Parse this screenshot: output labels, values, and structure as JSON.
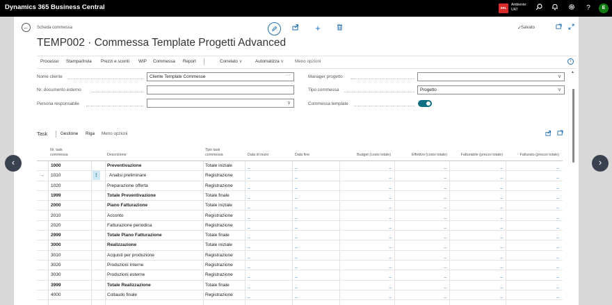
{
  "app": {
    "title": "Dynamics 365 Business Central"
  },
  "env": {
    "logo_text": "SRL",
    "line1": "Ambiente:",
    "line2": "UAT"
  },
  "user": {
    "initial": "E"
  },
  "page": {
    "breadcrumb": "Scheda commessa",
    "title": "TEMP002 · Commessa Template Progetti Advanced",
    "saved": "Salvato"
  },
  "menu": {
    "items": [
      "Processo",
      "Stampa/Invia",
      "Prezzi e sconti",
      "WIP",
      "Commessa",
      "Report",
      "Correlato",
      "Automatizza",
      "Meno opzioni"
    ]
  },
  "fields": {
    "nome_cliente": {
      "label": "Nome cliente",
      "value": "Cliente Template Commesse"
    },
    "nr_documento": {
      "label": "Nr. documento esterno",
      "value": ""
    },
    "persona": {
      "label": "Persona responsabile",
      "value": ""
    },
    "manager": {
      "label": "Manager progetto",
      "value": ""
    },
    "tipo": {
      "label": "Tipo commessa",
      "value": "Progetto"
    },
    "template": {
      "label": "Commessa template",
      "value": true
    }
  },
  "task_tabs": {
    "task": "Task",
    "gestione": "Gestione",
    "riga": "Riga",
    "meno": "Meno opzioni"
  },
  "grid": {
    "headers": [
      "Nr. task\ncommessa",
      "Descrizione",
      "Tipo task\ncommessa",
      "Data di inizio",
      "Data fine",
      "Budget (costo totale)",
      "Effettivo (costo totale)",
      "Fatturabile (prezzo totale)",
      "Fatturato (prezzo totale)"
    ],
    "rows": [
      {
        "no": "1000",
        "desc": "Preventivazione",
        "type": "Totale iniziale",
        "bold": true
      },
      {
        "no": "1010",
        "desc": "Analisi preliminare",
        "type": "Registrazione",
        "bold": false,
        "selected": true
      },
      {
        "no": "1020",
        "desc": "Preparazione offerta",
        "type": "Registrazione",
        "bold": false
      },
      {
        "no": "1999",
        "desc": "Totale Preventivazione",
        "type": "Totale finale",
        "bold": true
      },
      {
        "no": "2000",
        "desc": "Piano Fatturazione",
        "type": "Totale iniziale",
        "bold": true
      },
      {
        "no": "2010",
        "desc": "Acconto",
        "type": "Registrazione",
        "bold": false
      },
      {
        "no": "2020",
        "desc": "Fatturazione periodica",
        "type": "Registrazione",
        "bold": false
      },
      {
        "no": "2999",
        "desc": "Totale Piano Fatturazione",
        "type": "Totale finale",
        "bold": true
      },
      {
        "no": "3000",
        "desc": "Realizzazione",
        "type": "Totale iniziale",
        "bold": true
      },
      {
        "no": "3010",
        "desc": "Acquisti per produzione",
        "type": "Registrazione",
        "bold": false
      },
      {
        "no": "3020",
        "desc": "Produzioni interne",
        "type": "Registrazione",
        "bold": false
      },
      {
        "no": "3030",
        "desc": "Produzioni esterne",
        "type": "Registrazione",
        "bold": false
      },
      {
        "no": "3999",
        "desc": "Totale Realizzazione",
        "type": "Totale finale",
        "bold": true
      },
      {
        "no": "4000",
        "desc": "Collaudo finale",
        "type": "Registrazione",
        "bold": false
      }
    ],
    "empty_value": "_"
  },
  "icons": {
    "back": "←",
    "edit": "✎",
    "share": "⇪",
    "add": "+",
    "delete": "🗑",
    "search": "⚲",
    "bell": "🔔",
    "gear": "⚙",
    "help": "?",
    "info": "i",
    "prev": "‹",
    "next": "›"
  },
  "colors": {
    "accent": "#1f6fb3",
    "toggle": "#0e6f83",
    "selected": "#cfe8f4"
  }
}
